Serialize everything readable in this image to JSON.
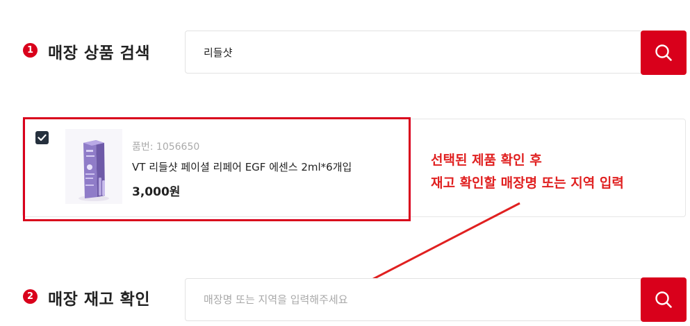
{
  "step1": {
    "number": "1",
    "title": "매장 상품 검색",
    "search_value": "리들샷"
  },
  "product": {
    "checked": true,
    "code": "품번: 1056650",
    "name": "VT 리들샷 페이셜 리페어 EGF 에센스 2ml*6개입",
    "price": "3,000원"
  },
  "annotation": {
    "line1": "선택된 제품 확인 후",
    "line2": "재고 확인할 매장명 또는 지역 입력"
  },
  "step2": {
    "number": "2",
    "title": "매장 재고 확인",
    "placeholder": "매장명 또는 지역을 입력해주세요"
  },
  "icons": {
    "search": "search-icon",
    "check": "check-icon",
    "number": "number-badge"
  },
  "colors": {
    "accent": "#d9001b",
    "annotation": "#e02020",
    "checkbox": "#25303d"
  }
}
